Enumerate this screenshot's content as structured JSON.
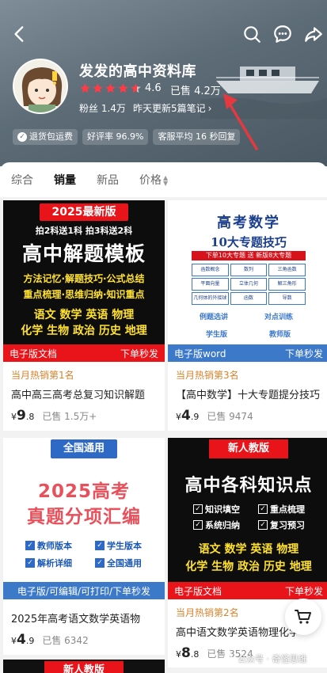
{
  "colors": {
    "accent_red": "#e8141a",
    "hot_orange": "#d9822b",
    "star_red": "#ff3b46",
    "blue": "#3d79c9"
  },
  "shop": {
    "name": "发发的高中资料库",
    "rating": "4.6",
    "sold": "已售 4.2万",
    "stars": 4.6,
    "fans": "粉丝 1.4万",
    "update": "昨天更新5篇笔记",
    "tags": [
      {
        "label": "退货包运费",
        "icon": "shield-check-icon"
      },
      {
        "label": "好评率 96.9%"
      },
      {
        "label": "客服平均 16 秒回复"
      }
    ]
  },
  "tabs": [
    "综合",
    "销量",
    "新品",
    "价格"
  ],
  "products": [
    {
      "hot": "当月热销第1名",
      "title": "高中高三高考总复习知识解题",
      "price_int": "9",
      "price_dec": ".8",
      "currency": "¥",
      "sold": "已售 1.5万+",
      "cover": {
        "badge": "2025最新版",
        "sub": "拍2科送1科  拍3科送2科",
        "main": "高中解题模板",
        "line1": "方法记忆·解题技巧·公式总结",
        "line2": "重点梳理·思维归纳·知识重点",
        "subj1": "语文  数学  英语  物理",
        "subj2": "化学  生物  政治  历史  地理",
        "bar_left": "电子版文档",
        "bar_right": "下单秒发"
      }
    },
    {
      "hot": "当月热销第3名",
      "title": "【高中数学】十大专题提分技巧",
      "price_int": "4",
      "price_dec": ".9",
      "currency": "¥",
      "sold": "已售 9474",
      "cover": {
        "title": "高考数学",
        "sub": "10大专题技巧",
        "red": "下单10大专题  送  新版8大专题",
        "cells": [
          "函数概念",
          "数列",
          "三角函数",
          "平面向量",
          "立体几何",
          "解三角形",
          "几何体的外接球",
          "函数",
          "导数"
        ],
        "l1": "例题选讲",
        "l2": "对点训练",
        "l3": "学生版",
        "l4": "教师版",
        "bar_left": "电子版word",
        "bar_right": "下单秒发"
      }
    },
    {
      "title": "2025年高考语文数学英语物",
      "price_int": "4",
      "price_dec": ".9",
      "currency": "¥",
      "sold": "已售 6342",
      "cover": {
        "badge": "全国通用",
        "t1": "2025高考",
        "t2": "真题分项汇编",
        "k1": "教师版本",
        "k2": "学生版本",
        "k3": "解析详细",
        "k4": "全国通用",
        "bar": "电子版/可编辑/可打印/下单秒发"
      }
    },
    {
      "hot": "当月热销第2名",
      "title": "高中语文数学英语物理化学",
      "price_int": "8",
      "price_dec": ".8",
      "currency": "¥",
      "sold": "已售 3524",
      "cover": {
        "badge": "新人教版",
        "main": "高中各科知识点",
        "k1": "知识填空",
        "k2": "重点梳理",
        "k3": "系统归纳",
        "k4": "复习预习",
        "subj1": "语文  数学  英语  物理",
        "subj2": "化学  生物  政治  历史  地理",
        "bar_left": "电子版文档",
        "bar_right": "下单秒发"
      }
    },
    {
      "cover": {
        "badge": "新人教版"
      }
    }
  ],
  "watermark": "公众号 · 奇怪思维"
}
